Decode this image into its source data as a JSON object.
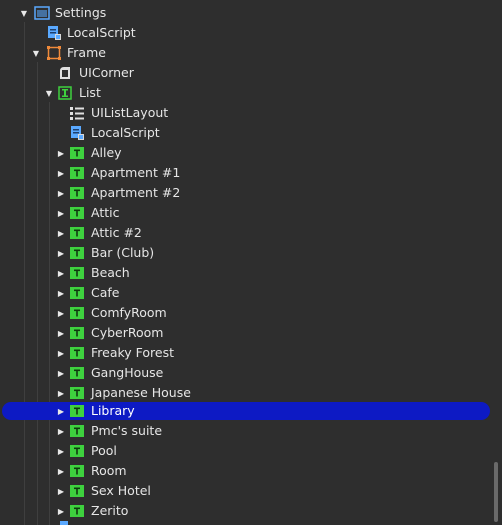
{
  "explorer": {
    "nodes": [
      {
        "label": "Settings",
        "icon": "screen-gui-icon",
        "expanded": true
      },
      {
        "label": "LocalScript",
        "icon": "local-script-icon"
      },
      {
        "label": "Frame",
        "icon": "frame-icon",
        "expanded": true
      },
      {
        "label": "UICorner",
        "icon": "ui-corner-icon"
      },
      {
        "label": "List",
        "icon": "scrolling-frame-icon",
        "expanded": true
      },
      {
        "label": "UIListLayout",
        "icon": "list-layout-icon"
      },
      {
        "label": "LocalScript",
        "icon": "local-script-icon"
      },
      {
        "label": "Alley",
        "icon": "text-button-icon"
      },
      {
        "label": "Apartment #1",
        "icon": "text-button-icon"
      },
      {
        "label": "Apartment #2",
        "icon": "text-button-icon"
      },
      {
        "label": "Attic",
        "icon": "text-button-icon"
      },
      {
        "label": "Attic #2",
        "icon": "text-button-icon"
      },
      {
        "label": "Bar (Club)",
        "icon": "text-button-icon"
      },
      {
        "label": "Beach",
        "icon": "text-button-icon"
      },
      {
        "label": "Cafe",
        "icon": "text-button-icon"
      },
      {
        "label": "ComfyRoom",
        "icon": "text-button-icon"
      },
      {
        "label": "CyberRoom",
        "icon": "text-button-icon"
      },
      {
        "label": "Freaky Forest",
        "icon": "text-button-icon"
      },
      {
        "label": "GangHouse",
        "icon": "text-button-icon"
      },
      {
        "label": "Japanese House",
        "icon": "text-button-icon"
      },
      {
        "label": "Library",
        "icon": "text-button-icon",
        "selected": true
      },
      {
        "label": "Pmc's suite",
        "icon": "text-button-icon"
      },
      {
        "label": "Pool",
        "icon": "text-button-icon"
      },
      {
        "label": "Room",
        "icon": "text-button-icon"
      },
      {
        "label": "Sex Hotel",
        "icon": "text-button-icon"
      },
      {
        "label": "Zerito",
        "icon": "text-button-icon"
      }
    ]
  },
  "colors": {
    "background": "#2e2e2e",
    "selection": "#0d1ac4",
    "button_icon_green": "#3ed13e",
    "script_icon_blue": "#5aa9ff",
    "frame_icon_orange": "#f08a3a"
  }
}
